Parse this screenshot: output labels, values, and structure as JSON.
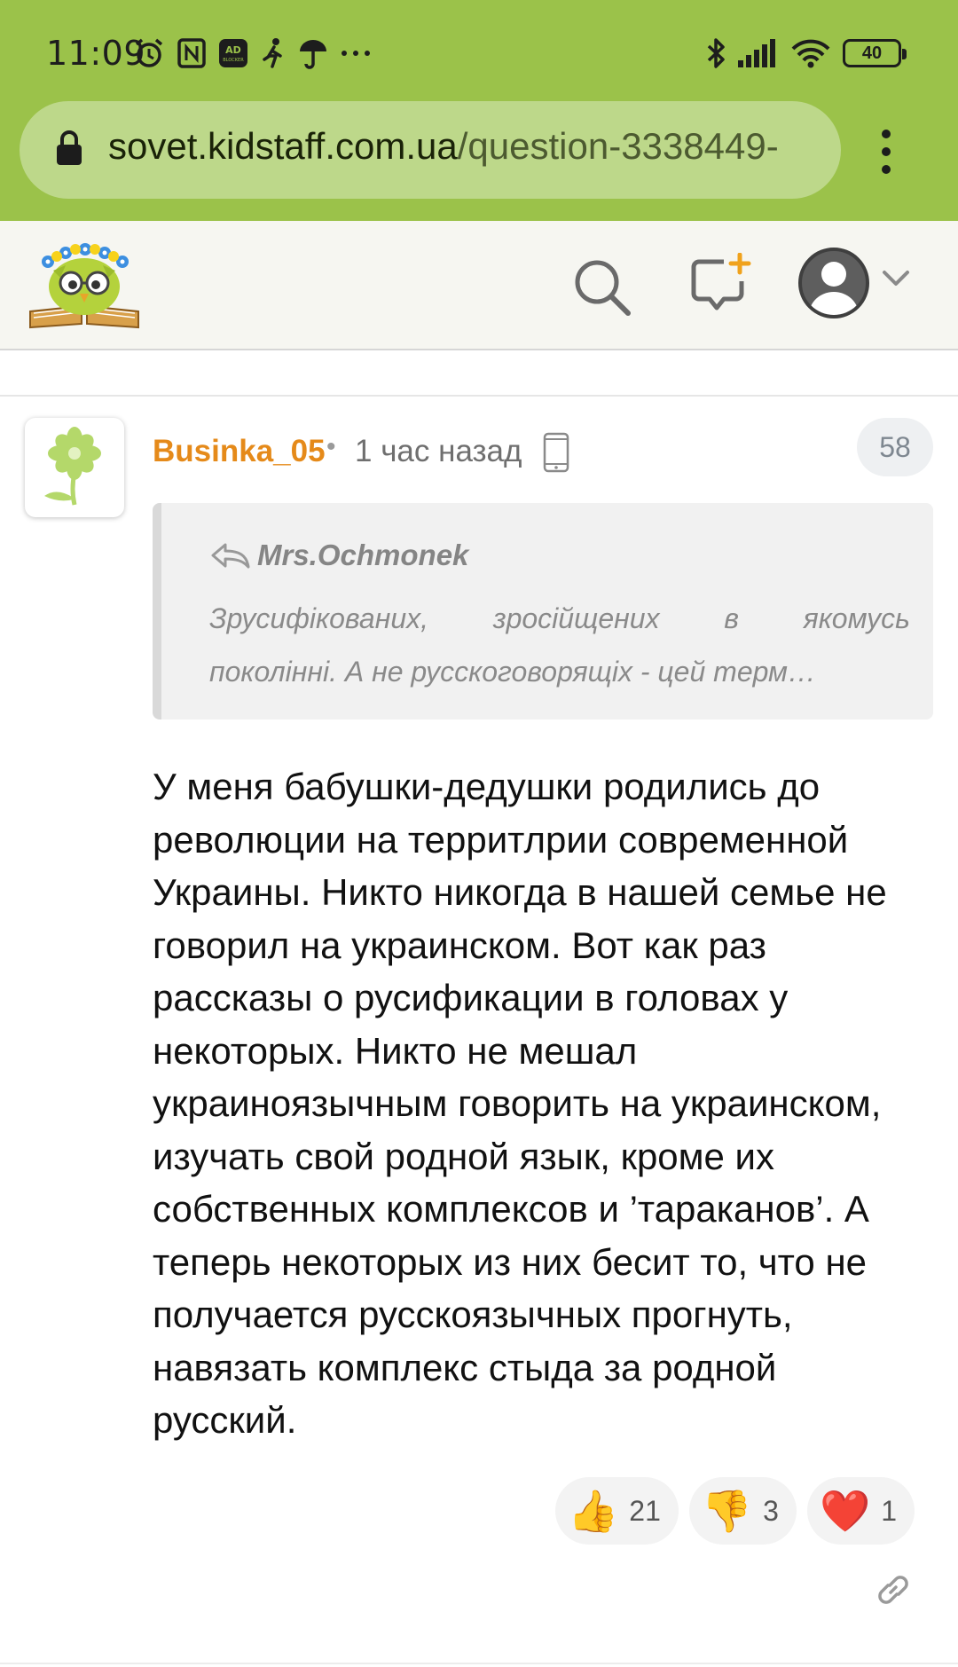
{
  "status_bar": {
    "time": "11:09",
    "battery": "40",
    "left_icons": [
      "alarm-icon",
      "nfc-icon",
      "ad-blocker-icon",
      "person-walk-icon",
      "umbrella-icon",
      "more-dots-icon"
    ],
    "right_icons": [
      "bluetooth-icon",
      "signal-icon",
      "wifi-icon",
      "battery-icon"
    ]
  },
  "browser": {
    "url_host": "sovet.kidstaff.com.ua",
    "url_path": "/question-3338449-",
    "menu_icon": "overflow-menu-icon"
  },
  "site_header": {
    "logo": "kidstaff-owl-logo",
    "icons": [
      "search-icon",
      "new-message-icon",
      "user-avatar-icon",
      "chevron-down-icon"
    ]
  },
  "post": {
    "author": "Businka_05",
    "separator": "•",
    "time_ago": "1 час назад",
    "device_icon": "mobile-phone-icon",
    "count": "58",
    "quote": {
      "author": "Mrs.Ochmonek",
      "line1": "Зрусифікованих, зросійщених в якомусь",
      "line2": "поколінні. А не русскоговорящіх - цей терм…"
    },
    "body": "У меня бабушки-дедушки родились до революции на территлрии современной Украины. Никто никогда в нашей семье не говорил на украинском. Вот как раз рассказы о русификации в головах у некоторых. Никто не мешал украиноязычным говорить на украинском, изучать свой родной язык, кроме их собственных комплексов и ’тараканов’. А теперь некоторых из них бесит то, что не получается русскоязычных прогнуть, навязать комплекс стыда за родной русский.",
    "reactions": [
      {
        "emoji": "👍",
        "count": "21"
      },
      {
        "emoji": "👎",
        "count": "3"
      },
      {
        "emoji": "❤️",
        "count": "1"
      }
    ],
    "link_icon": "link-icon"
  },
  "colors": {
    "chrome_green": "#9bc24a",
    "url_pill": "#bdd88a",
    "author_orange": "#e58a1a"
  }
}
